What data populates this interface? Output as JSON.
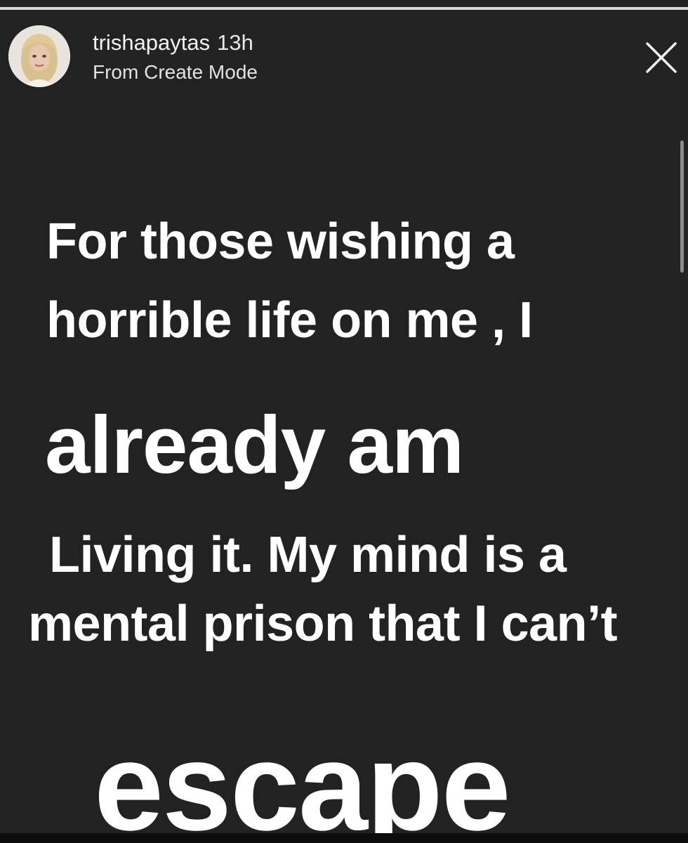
{
  "story": {
    "username": "trishapaytas",
    "time_ago": "13h",
    "subtitle": "From Create Mode",
    "progress_fraction": 1.0,
    "text_lines": [
      "For those wishing a",
      "horrible life on me , I",
      "already am",
      "Living it. My mind is a",
      "mental prison that I can’t",
      "escape"
    ]
  },
  "icons": {
    "close": "close-icon",
    "avatar": "avatar-photo"
  },
  "colors": {
    "background": "#222222",
    "text": "#ffffff",
    "secondary_text": "#e2e2e2"
  }
}
